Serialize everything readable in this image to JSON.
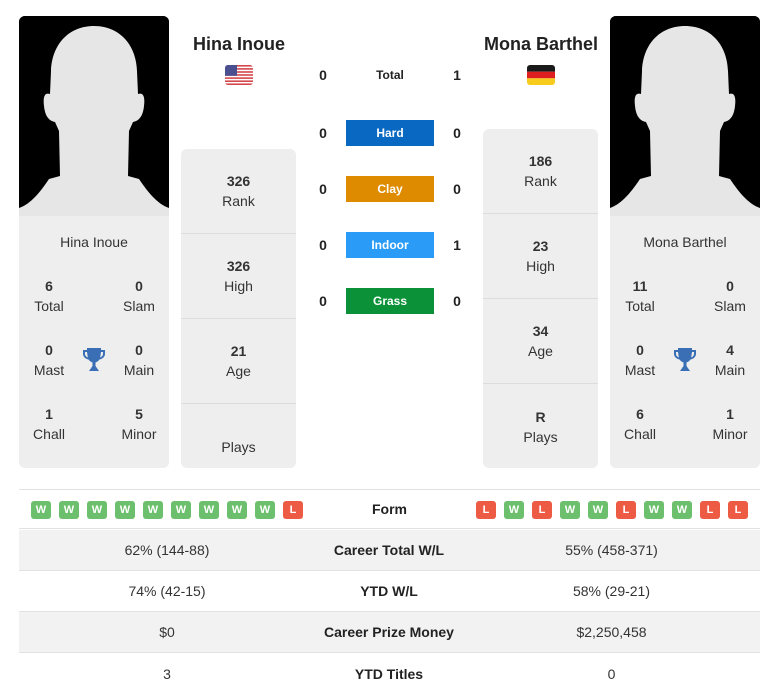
{
  "player1": {
    "name": "Hina Inoue",
    "country_flag": "usa-flag-icon",
    "titles": {
      "total": {
        "value": "6",
        "label": "Total"
      },
      "slam": {
        "value": "0",
        "label": "Slam"
      },
      "mast": {
        "value": "0",
        "label": "Mast"
      },
      "main": {
        "value": "0",
        "label": "Main"
      },
      "chall": {
        "value": "1",
        "label": "Chall"
      },
      "minor": {
        "value": "5",
        "label": "Minor"
      }
    },
    "rank": {
      "value": "326",
      "label": "Rank"
    },
    "high": {
      "value": "326",
      "label": "High"
    },
    "age": {
      "value": "21",
      "label": "Age"
    },
    "plays": {
      "value": "",
      "label": "Plays"
    },
    "form": [
      "W",
      "W",
      "W",
      "W",
      "W",
      "W",
      "W",
      "W",
      "W",
      "L"
    ]
  },
  "player2": {
    "name": "Mona Barthel",
    "country_flag": "germany-flag-icon",
    "titles": {
      "total": {
        "value": "11",
        "label": "Total"
      },
      "slam": {
        "value": "0",
        "label": "Slam"
      },
      "mast": {
        "value": "0",
        "label": "Mast"
      },
      "main": {
        "value": "4",
        "label": "Main"
      },
      "chall": {
        "value": "6",
        "label": "Chall"
      },
      "minor": {
        "value": "1",
        "label": "Minor"
      }
    },
    "rank": {
      "value": "186",
      "label": "Rank"
    },
    "high": {
      "value": "23",
      "label": "High"
    },
    "age": {
      "value": "34",
      "label": "Age"
    },
    "plays": {
      "value": "R",
      "label": "Plays"
    },
    "form": [
      "L",
      "W",
      "L",
      "W",
      "W",
      "L",
      "W",
      "W",
      "L",
      "L"
    ]
  },
  "h2h": [
    {
      "label": "Total",
      "left": "0",
      "right": "1",
      "color": null
    },
    {
      "label": "Hard",
      "left": "0",
      "right": "0",
      "color": "#0868c2"
    },
    {
      "label": "Clay",
      "left": "0",
      "right": "0",
      "color": "#de8b00"
    },
    {
      "label": "Indoor",
      "left": "0",
      "right": "1",
      "color": "#2a9bf7"
    },
    {
      "label": "Grass",
      "left": "0",
      "right": "0",
      "color": "#0b9238"
    }
  ],
  "form_label": "Form",
  "stats": [
    {
      "label": "Career Total W/L",
      "left": "62% (144-88)",
      "right": "55% (458-371)"
    },
    {
      "label": "YTD W/L",
      "left": "74% (42-15)",
      "right": "58% (29-21)"
    },
    {
      "label": "Career Prize Money",
      "left": "$0",
      "right": "$2,250,458"
    },
    {
      "label": "YTD Titles",
      "left": "3",
      "right": "0"
    }
  ]
}
